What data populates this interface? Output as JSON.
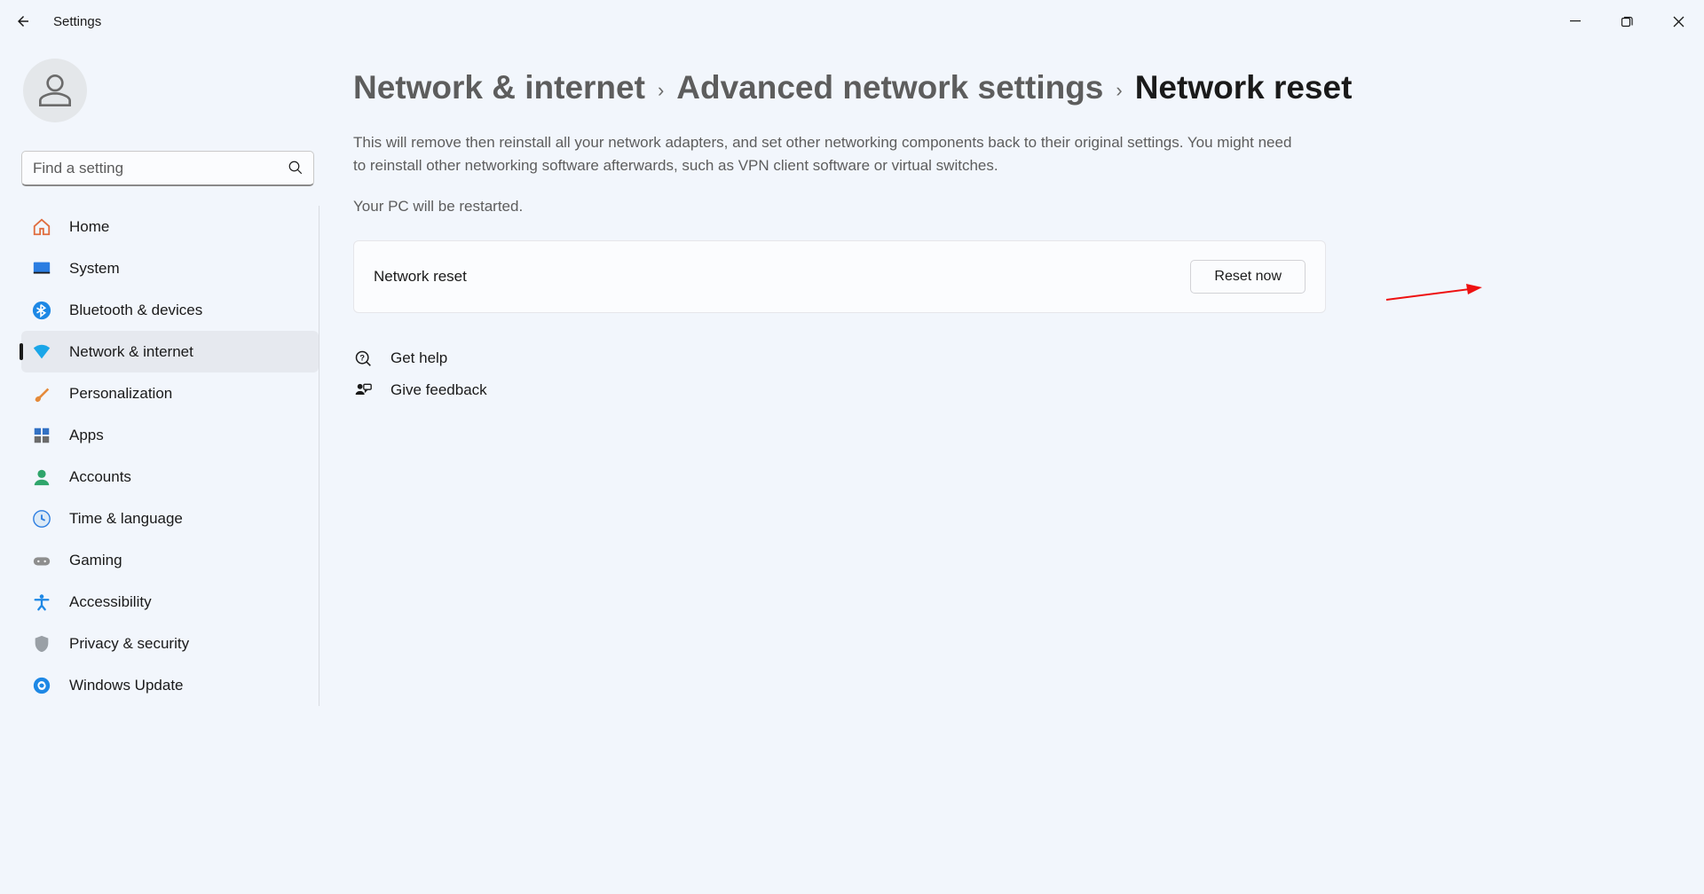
{
  "window": {
    "title": "Settings"
  },
  "search": {
    "placeholder": "Find a setting"
  },
  "sidebar": {
    "items": [
      {
        "id": "home",
        "label": "Home"
      },
      {
        "id": "system",
        "label": "System"
      },
      {
        "id": "bluetooth",
        "label": "Bluetooth & devices"
      },
      {
        "id": "network",
        "label": "Network & internet",
        "active": true
      },
      {
        "id": "personalization",
        "label": "Personalization"
      },
      {
        "id": "apps",
        "label": "Apps"
      },
      {
        "id": "accounts",
        "label": "Accounts"
      },
      {
        "id": "time",
        "label": "Time & language"
      },
      {
        "id": "gaming",
        "label": "Gaming"
      },
      {
        "id": "accessibility",
        "label": "Accessibility"
      },
      {
        "id": "privacy",
        "label": "Privacy & security"
      },
      {
        "id": "update",
        "label": "Windows Update"
      }
    ]
  },
  "breadcrumb": {
    "level1": "Network & internet",
    "level2": "Advanced network settings",
    "current": "Network reset"
  },
  "page": {
    "description": "This will remove then reinstall all your network adapters, and set other networking components back to their original settings. You might need to reinstall other networking software afterwards, such as VPN client software or virtual switches.",
    "restart_note": "Your PC will be restarted.",
    "card_label": "Network reset",
    "reset_button": "Reset now"
  },
  "footer": {
    "help": "Get help",
    "feedback": "Give feedback"
  }
}
